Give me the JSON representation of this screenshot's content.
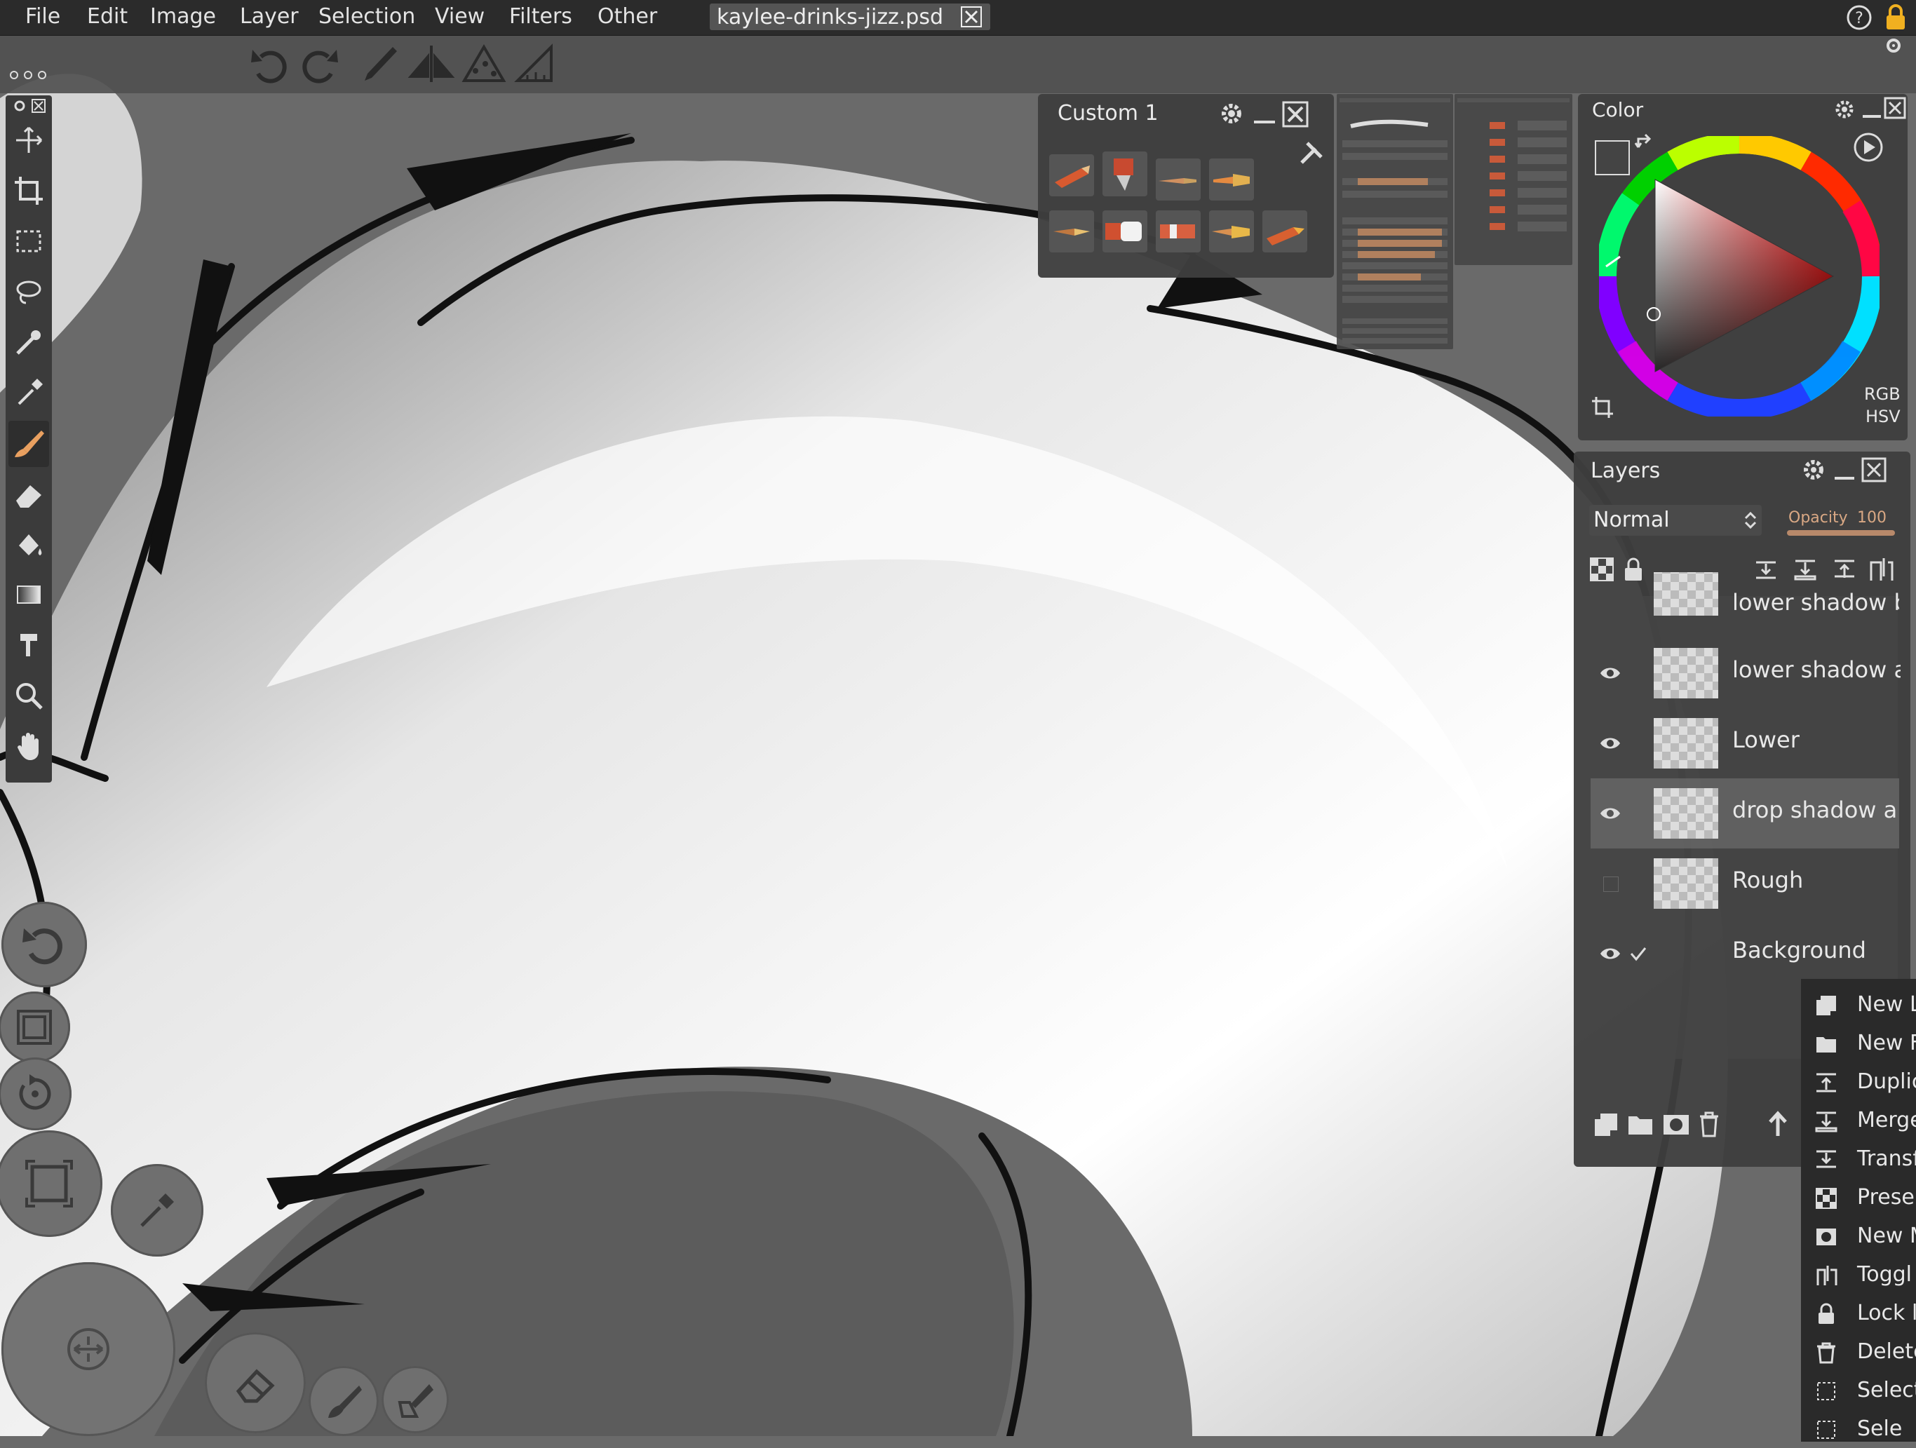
{
  "menubar": {
    "items": [
      "File",
      "Edit",
      "Image",
      "Layer",
      "Selection",
      "View",
      "Filters",
      "Other"
    ],
    "document_tab": "kaylee-drinks-jizz.psd"
  },
  "custom_panel": {
    "title": "Custom 1"
  },
  "color_panel": {
    "title": "Color",
    "mode_rgb": "RGB",
    "mode_hsv": "HSV"
  },
  "layers_panel": {
    "title": "Layers",
    "blend_mode": "Normal",
    "opacity_label": "Opacity",
    "opacity_value": "100",
    "layers": [
      {
        "name": "lower shadow b",
        "visible": true
      },
      {
        "name": "lower shadow a",
        "visible": true
      },
      {
        "name": "Lower",
        "visible": true
      },
      {
        "name": "drop shadow a",
        "visible": true,
        "selected": true
      },
      {
        "name": "Rough",
        "visible": false
      },
      {
        "name": "Background",
        "visible": true,
        "checked": true
      }
    ]
  },
  "context_menu": {
    "items": [
      "New L",
      "New F",
      "Duplic",
      "Merge",
      "Transf",
      "Preser",
      "New M",
      "Toggl",
      "Lock l",
      "Delete",
      "Select",
      "Sele"
    ]
  },
  "colors": {
    "menubar_bg": "#2b2b2b",
    "panel_bg": "#3e3e3e",
    "opacity_slider": "#b8896a",
    "canvas_bg": "#6a6a6a"
  }
}
